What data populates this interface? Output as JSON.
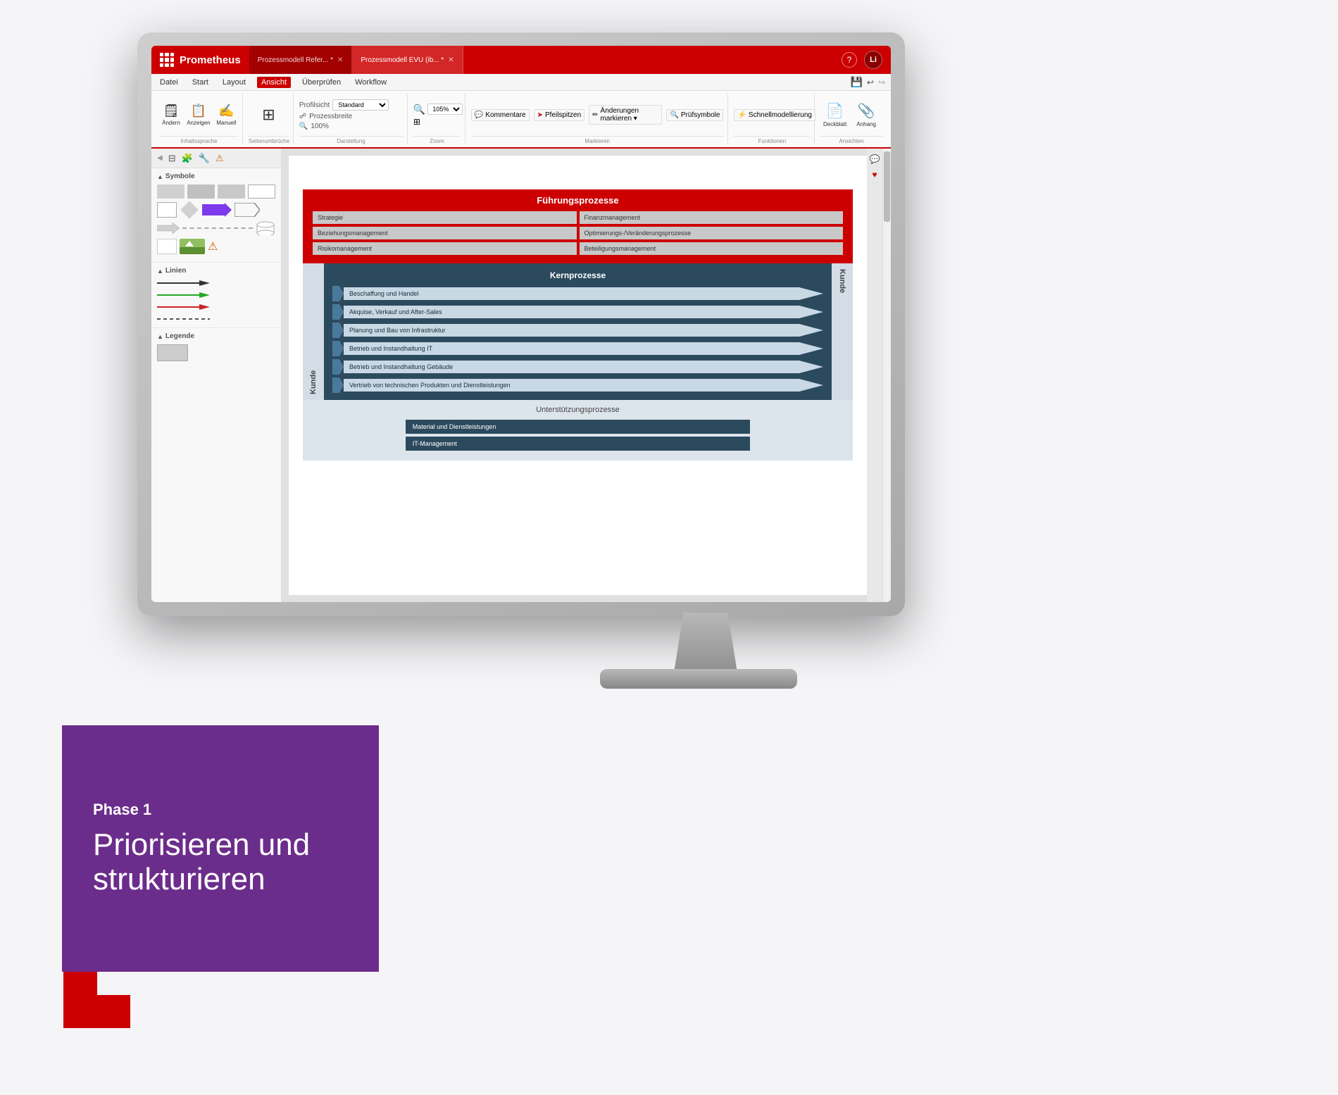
{
  "app": {
    "name": "Prometheus",
    "tabs": [
      {
        "label": "Prozessmodell Refer... *",
        "active": false
      },
      {
        "label": "Prozessmodell EVU (ib... *",
        "active": true
      }
    ],
    "question_label": "?",
    "user_label": "Li"
  },
  "menubar": {
    "items": [
      "Datei",
      "Start",
      "Layout",
      "Ansicht",
      "Überprüfen",
      "Workflow"
    ]
  },
  "ribbon": {
    "groups": [
      {
        "label": "Inhaltssprache",
        "items": [
          "Ändern",
          "Anzeigen",
          "Manuell"
        ]
      },
      {
        "label": "Seitenumbrüche",
        "items": []
      },
      {
        "label": "Darstellung",
        "profilsicht_label": "Profilsicht",
        "profilsicht_value": "Standard",
        "items": [
          "Prozessbreite",
          "100%"
        ]
      },
      {
        "label": "Zoom",
        "zoom_value": "105%",
        "items": []
      },
      {
        "label": "Markieren",
        "items": [
          "Kommentare",
          "Pfeilspitzen",
          "Änderungen markieren",
          "Prüfsymbole"
        ]
      },
      {
        "label": "Funktionen",
        "items": [
          "Schnellmodellierung"
        ]
      },
      {
        "label": "Ansichten",
        "items": [
          "Deckblatt",
          "Anhang"
        ]
      }
    ]
  },
  "diagram": {
    "fuehrung": {
      "title": "Führungsprozesse",
      "boxes": [
        "Strategie",
        "Finanzmanagement",
        "Beziehungsmanagement",
        "Optimierungs-/Veränderungsprozesse",
        "Risikomanagement",
        "Beteiligungsmanagement"
      ]
    },
    "kern": {
      "title": "Kernprozesse",
      "customer_left": "Kunde",
      "customer_right": "Kunde",
      "processes": [
        "Beschaffung und Handel",
        "Akquise, Verkauf und After-Sales",
        "Planung und Bau von Infrastruktur",
        "Betrieb und Instandhaltung IT",
        "Betrieb und Instandhaltung Gebäude",
        "Vertrieb von technischen Produkten und Dienstleistungen"
      ]
    },
    "unterstuetz": {
      "title": "Unterstützungsprozesse",
      "boxes": [
        "Material und Dienstleistungen",
        "IT-Management"
      ]
    }
  },
  "sidebar": {
    "sections": [
      {
        "label": "Symbole",
        "shapes": [
          "rect",
          "rect-gray",
          "rect-lg",
          "diamond",
          "chevron",
          "arrow",
          "process",
          "cylinder"
        ]
      },
      {
        "label": "Linien",
        "lines": [
          "solid-black",
          "solid-green",
          "solid-red",
          "dashed"
        ]
      },
      {
        "label": "Legende",
        "items": [
          "legend-box"
        ]
      }
    ]
  },
  "overlay": {
    "phase_label": "Phase 1",
    "title_line1": "Priorisieren und",
    "title_line2": "strukturieren"
  },
  "colors": {
    "brand_red": "#cc0000",
    "brand_purple": "#6b2d8b",
    "kern_dark": "#2c4a5e",
    "kern_light": "#c8d8e4"
  }
}
